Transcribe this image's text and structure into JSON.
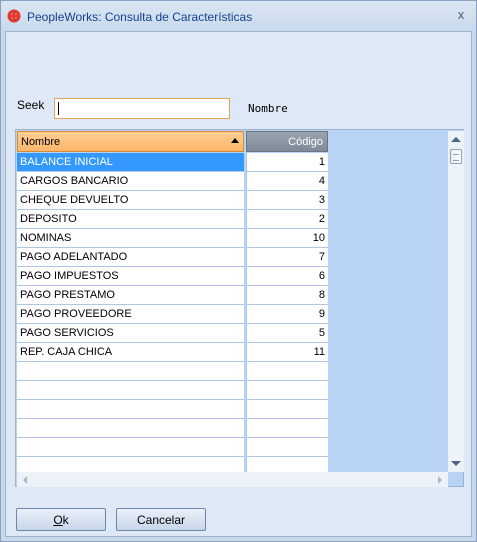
{
  "window": {
    "title": "PeopleWorks: Consulta de Características",
    "close_glyph": "x"
  },
  "search": {
    "label": "Seek",
    "value": "",
    "field_name": "Nombre"
  },
  "grid": {
    "columns": [
      "Nombre",
      "Código"
    ],
    "sort": "ascending",
    "selected_index": 0,
    "rows": [
      {
        "nombre": "BALANCE INICIAL",
        "codigo": "1"
      },
      {
        "nombre": "CARGOS BANCARIO",
        "codigo": "4"
      },
      {
        "nombre": "CHEQUE DEVUELTO",
        "codigo": "3"
      },
      {
        "nombre": "DEPOSITO",
        "codigo": "2"
      },
      {
        "nombre": "NOMINAS",
        "codigo": "10"
      },
      {
        "nombre": "PAGO ADELANTADO",
        "codigo": "7"
      },
      {
        "nombre": "PAGO IMPUESTOS",
        "codigo": "6"
      },
      {
        "nombre": "PAGO PRESTAMO",
        "codigo": "8"
      },
      {
        "nombre": "PAGO PROVEEDORE",
        "codigo": "9"
      },
      {
        "nombre": "PAGO SERVICIOS",
        "codigo": "5"
      },
      {
        "nombre": "REP. CAJA CHICA",
        "codigo": "11"
      },
      {
        "nombre": "",
        "codigo": ""
      },
      {
        "nombre": "",
        "codigo": ""
      },
      {
        "nombre": "",
        "codigo": ""
      },
      {
        "nombre": "",
        "codigo": ""
      },
      {
        "nombre": "",
        "codigo": ""
      },
      {
        "nombre": "",
        "codigo": ""
      }
    ]
  },
  "buttons": {
    "ok_first": "O",
    "ok_rest": "k",
    "cancel": "Cancelar"
  },
  "colors": {
    "selection": "#3399ff",
    "header_active": "#fbb66b",
    "header_inactive": "#7f8a98",
    "grid_background": "#b9d3f5",
    "dialog_background": "#dfe8f6"
  },
  "icons": {
    "app": "erp-logo-icon",
    "close": "close-icon",
    "sort": "sort-ascending-icon"
  }
}
